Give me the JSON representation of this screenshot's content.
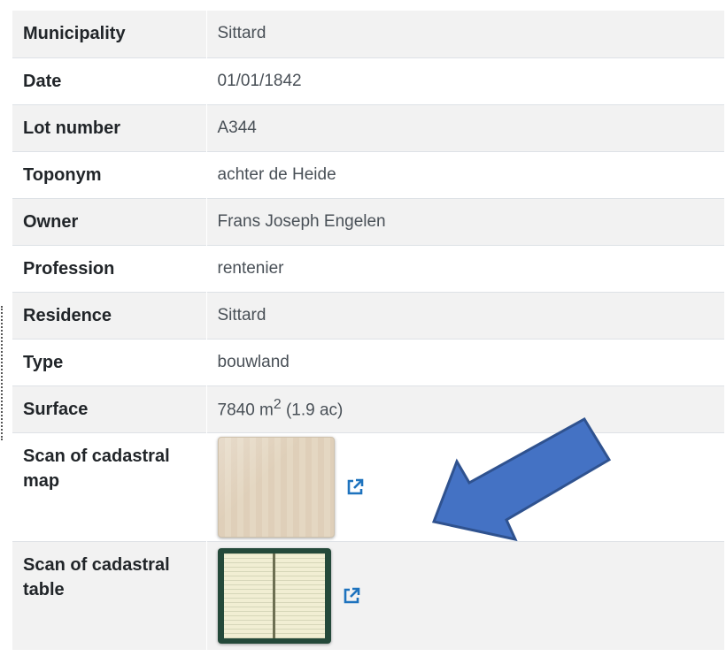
{
  "rows": {
    "municipality": {
      "label": "Municipality",
      "value": "Sittard"
    },
    "date": {
      "label": "Date",
      "value": "01/01/1842"
    },
    "lot": {
      "label": "Lot number",
      "value": "A344"
    },
    "toponym": {
      "label": "Toponym",
      "value": "achter de Heide"
    },
    "owner": {
      "label": "Owner",
      "value": "Frans Joseph Engelen"
    },
    "profession": {
      "label": "Profession",
      "value": "rentenier"
    },
    "residence": {
      "label": "Residence",
      "value": "Sittard"
    },
    "type": {
      "label": "Type",
      "value": "bouwland"
    },
    "surface": {
      "label": "Surface",
      "value_number": "7840 m",
      "value_sup": "2",
      "value_rest": " (1.9 ac)"
    },
    "scan_map": {
      "label": "Scan of cadastral map"
    },
    "scan_table": {
      "label": "Scan of cadastral table"
    }
  },
  "icons": {
    "external_link": "external-link-icon",
    "arrow": "arrow-icon"
  },
  "colors": {
    "link_icon": "#1e73be",
    "arrow_fill": "#4472c4",
    "arrow_stroke": "#2f528f",
    "row_stripe": "#f2f2f2"
  }
}
